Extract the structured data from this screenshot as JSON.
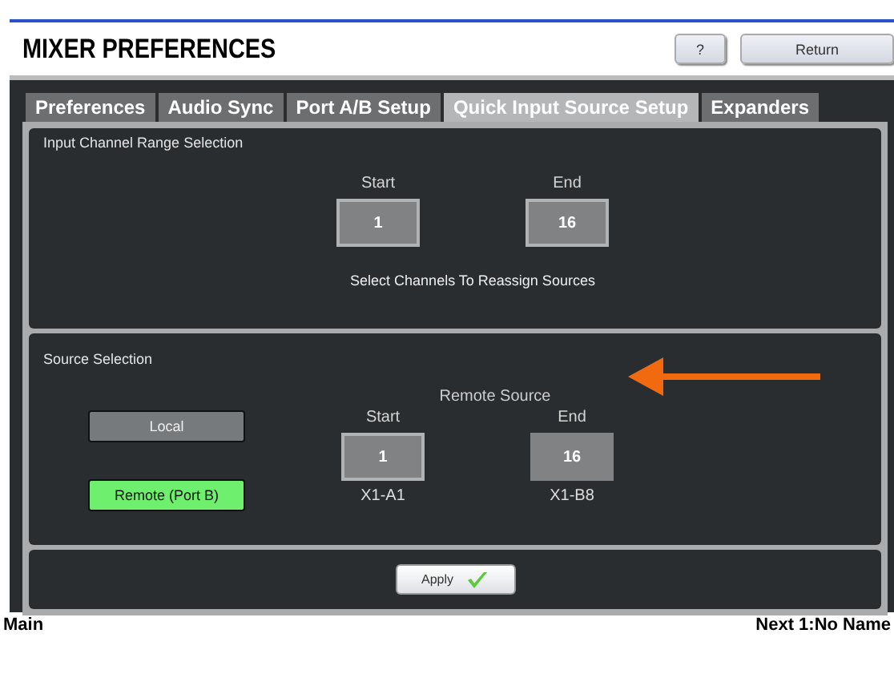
{
  "header": {
    "title": "MIXER PREFERENCES",
    "buttons": [
      "?",
      "Return"
    ]
  },
  "tabs": [
    {
      "label": "Preferences",
      "selected": false
    },
    {
      "label": "Audio Sync",
      "selected": false
    },
    {
      "label": "Port A/B Setup",
      "selected": false
    },
    {
      "label": "Quick Input Source Setup",
      "selected": true
    },
    {
      "label": "Expanders",
      "selected": false
    }
  ],
  "channel_range": {
    "title": "Input Channel Range Selection",
    "start": {
      "label": "Start",
      "value": "1"
    },
    "end": {
      "label": "End",
      "value": "16"
    },
    "hint": "Select Channels To Reassign Sources"
  },
  "source_selection": {
    "title": "Source Selection",
    "options": [
      {
        "label": "Local",
        "selected": false
      },
      {
        "label": "Remote (Port B)",
        "selected": true
      }
    ],
    "remote_title": "Remote Source",
    "start": {
      "label": "Start",
      "value": "1",
      "socket": "X1-A1"
    },
    "end": {
      "label": "End",
      "value": "16",
      "socket": "X1-B8"
    }
  },
  "apply_button": "Apply",
  "status_bar": {
    "left": "Main",
    "right": "Next 1:No Name"
  }
}
